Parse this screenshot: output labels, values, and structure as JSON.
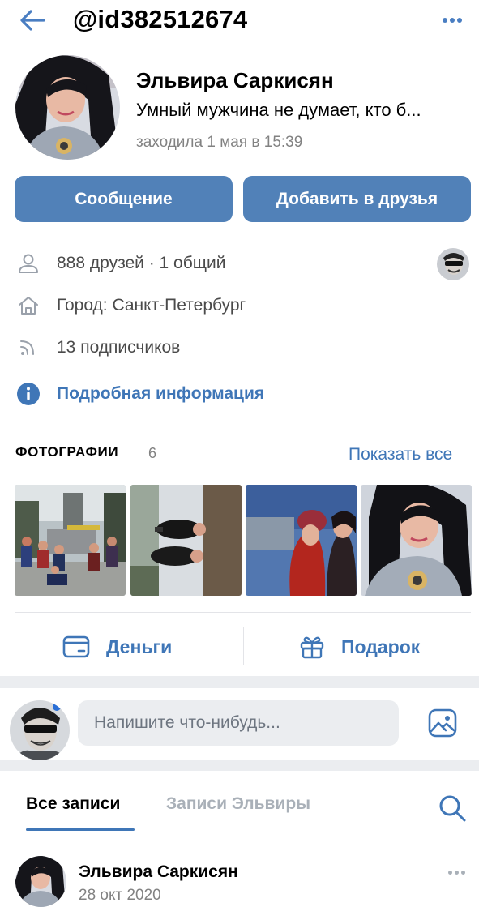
{
  "header": {
    "title": "@id382512674",
    "back_icon": "arrow-left-icon",
    "more_icon": "more-horizontal-icon"
  },
  "profile": {
    "name": "Эльвира Саркисян",
    "status": "Умный мужчина не думает, кто б...",
    "last_seen": "заходила 1 мая в 15:39"
  },
  "buttons": {
    "message": "Сообщение",
    "add_friend": "Добавить в друзья"
  },
  "info": {
    "friends": "888 друзей · 1 общий",
    "city": "Город: Санкт-Петербург",
    "followers": "13 подписчиков",
    "details": "Подробная информация"
  },
  "photos": {
    "heading": "ФОТОГРАФИИ",
    "count": "6",
    "show_all": "Показать все"
  },
  "actions": {
    "money": "Деньги",
    "gift": "Подарок"
  },
  "composer": {
    "placeholder": "Напишите что-нибудь..."
  },
  "tabs": [
    {
      "label": "Все записи",
      "active": true
    },
    {
      "label": "Записи Эльвиры",
      "active": false
    }
  ],
  "post": {
    "author": "Эльвира Саркисян",
    "date": "28 окт 2020"
  },
  "colors": {
    "accent": "#5181b8",
    "link": "#3f76b7",
    "muted": "#828282",
    "background_gap": "#ebedf0"
  }
}
